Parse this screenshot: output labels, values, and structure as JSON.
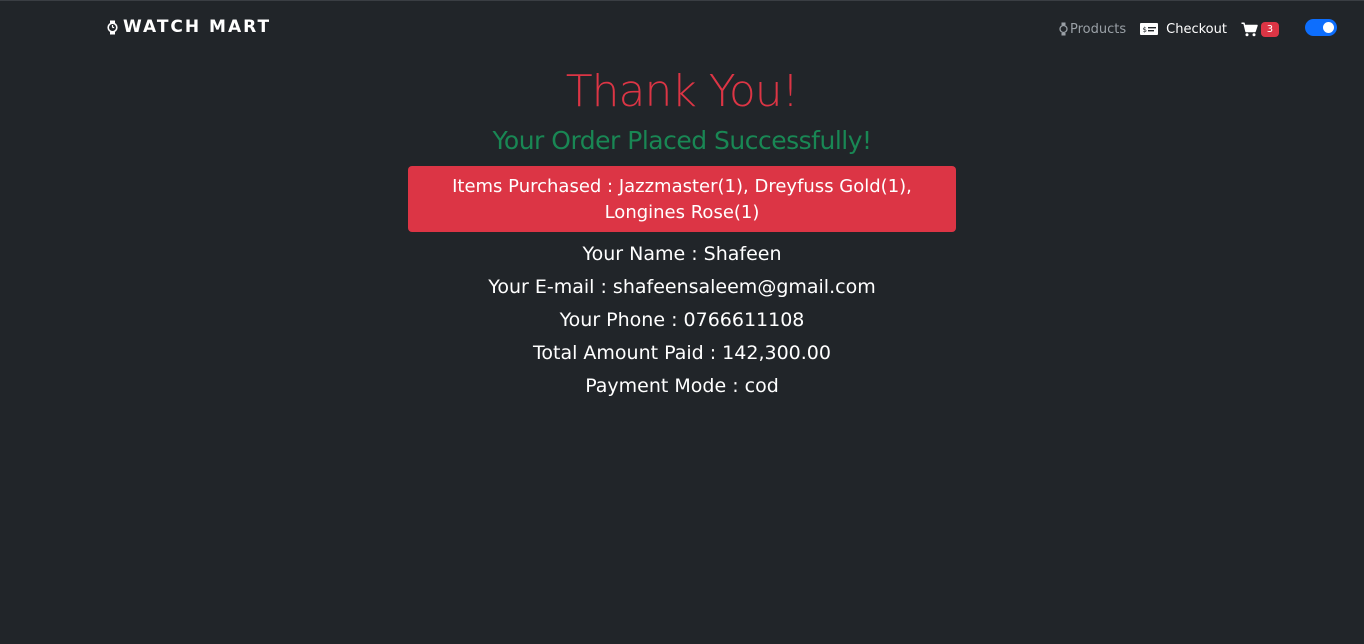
{
  "navbar": {
    "brand": "WATCH MART",
    "products_label": "Products",
    "checkout_label": "Checkout",
    "cart_count": "3"
  },
  "main": {
    "title": "Thank You!",
    "subtitle": "Your Order Placed Successfully!",
    "items_purchased": "Items Purchased : Jazzmaster(1), Dreyfuss Gold(1), Longines Rose(1)",
    "name": "Your Name : Shafeen",
    "email": "Your E-mail : shafeensaleem@gmail.com",
    "phone": "Your Phone : 0766611108",
    "amount": "Total Amount Paid : 142,300.00",
    "payment_mode": "Payment Mode : cod"
  },
  "colors": {
    "background": "#212529",
    "title_red": "#dc3545",
    "subtitle_green": "#198754",
    "toggle_blue": "#0d6efd"
  },
  "icons": {
    "brand": "watch-icon",
    "products": "watch-icon",
    "checkout": "money-bill-icon",
    "cart": "cart-icon"
  },
  "theme_toggle_on": true
}
